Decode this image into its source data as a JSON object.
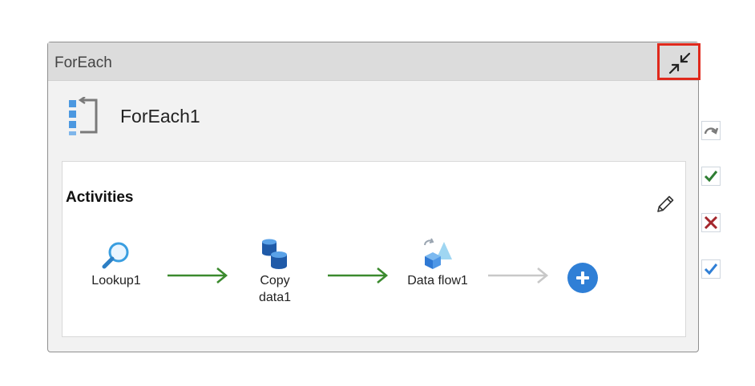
{
  "container": {
    "header_title": "ForEach",
    "collapse_tooltip": "Collapse",
    "activity_name": "ForEach1"
  },
  "activities_panel": {
    "title": "Activities",
    "nodes": [
      {
        "label_line1": "Lookup1",
        "label_line2": "",
        "icon": "lookup-icon"
      },
      {
        "label_line1": "Copy",
        "label_line2": "data1",
        "icon": "copy-data-icon"
      },
      {
        "label_line1": "Data flow1",
        "label_line2": "",
        "icon": "data-flow-icon"
      }
    ],
    "add_icon": "plus-icon"
  },
  "side_actions": [
    {
      "icon": "redo-icon"
    },
    {
      "icon": "success-check-icon",
      "color": "#2e7d32"
    },
    {
      "icon": "failure-x-icon",
      "color": "#a4262c"
    },
    {
      "icon": "completion-check-icon",
      "color": "#2f7fd6"
    }
  ],
  "colors": {
    "success_arrow": "#3b8a2e",
    "inactive_arrow": "#c8c8c8",
    "highlight_border": "#e0291c",
    "accent": "#2f7fd6"
  }
}
